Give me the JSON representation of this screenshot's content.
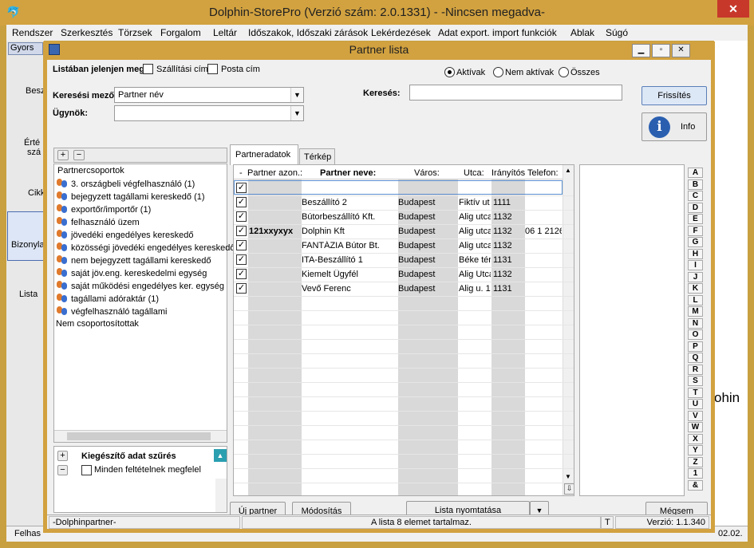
{
  "main_window": {
    "title": "Dolphin-StorePro  (Verzió szám: 2.0.1331) - -Nincsen megadva-",
    "close": "✕"
  },
  "menu": [
    "Rendszer",
    "Szerkesztés",
    "Törzsek",
    "Forgalom",
    "Leltár",
    "Időszakok, Időszaki zárások",
    "Lekérdezések",
    "Adat export. import funkciók",
    "Ablak",
    "Súgó"
  ],
  "background": {
    "fragments": [
      "Gyors",
      "Besz",
      "Érté",
      "szá",
      "Cikk",
      "Bizonyla",
      "Lista",
      "Felhas",
      "ohin",
      "02.02."
    ]
  },
  "child_window": {
    "title": "Partner lista",
    "filter_label": "Listában jelenjen meg:",
    "cb_shipping": "Szállítási cím",
    "cb_mail": "Posta cím",
    "radio_active": "Aktívak",
    "radio_inactive": "Nem aktívak",
    "radio_all": "Összes",
    "search_field_label": "Keresési mező:",
    "search_field_value": "Partner név",
    "agent_label": "Ügynök:",
    "search_label": "Keresés:",
    "refresh": "Frissítés",
    "info": "Info",
    "plus": "+",
    "minus": "−",
    "extra_filter": "Kiegészítő adat szűrés",
    "all_conditions": "Minden feltételnek megfelel",
    "tab_partner": "Partneradatok",
    "tab_map": "Térkép",
    "new_partner": "Új partner",
    "modify": "Módosítás",
    "print_list": "Lista nyomtatása",
    "cancel": "Mégsem",
    "status_left": "-Dolphinpartner-",
    "status_mid": "A lista 8 elemet tartalmaz.",
    "status_t": "T",
    "status_version": "Verzió: 1.1.340"
  },
  "tree": {
    "root": "Partnercsoportok",
    "items": [
      "3. országbeli végfelhasználó (1)",
      "bejegyzett tagállami kereskedő (1)",
      "exportőr/importőr (1)",
      "felhasználó üzem",
      "jövedéki engedélyes kereskedő",
      "közösségi jövedéki engedélyes kereskedő",
      "nem bejegyzett tagállami kereskedő",
      "saját jöv.eng. kereskedelmi egység",
      "saját működési engedélyes ker. egység",
      "tagállami adóraktár (1)",
      "végfelhasználó tagállami"
    ],
    "ungrouped": "Nem csoportosítottak"
  },
  "grid": {
    "headers": [
      "-",
      "Partner azon.:",
      "Partner neve:",
      "Város:",
      "Utca:",
      "Irányítós",
      "Telefon:"
    ],
    "rows": [
      {
        "id": "",
        "name": "",
        "city": "",
        "street": "",
        "zip": "",
        "phone": ""
      },
      {
        "id": "",
        "name": "Beszállító 2",
        "city": "Budapest",
        "street": "Fiktív ut",
        "zip": "1111",
        "phone": ""
      },
      {
        "id": "",
        "name": "Bútorbeszállító Kft.",
        "city": "Budapest",
        "street": "Alig utca",
        "zip": "1132",
        "phone": ""
      },
      {
        "id": "121xxyxyx",
        "name": "Dolphin Kft",
        "city": "Budapest",
        "street": "Alig utca",
        "zip": "1132",
        "phone": "06 1 2126"
      },
      {
        "id": "",
        "name": "FANTÁZIA Bútor Bt.",
        "city": "Budapest",
        "street": "Alig utca",
        "zip": "1132",
        "phone": ""
      },
      {
        "id": "",
        "name": "ITA-Beszállító 1",
        "city": "Budapest",
        "street": "Béke tér",
        "zip": "1131",
        "phone": ""
      },
      {
        "id": "",
        "name": "Kiemelt Ügyfél",
        "city": "Budapest",
        "street": "Alig Utca",
        "zip": "1132",
        "phone": ""
      },
      {
        "id": "",
        "name": "Vevő Ferenc",
        "city": "Budapest",
        "street": "Alig u. 1",
        "zip": "1131",
        "phone": ""
      }
    ]
  },
  "alphabet": [
    "A",
    "B",
    "C",
    "D",
    "E",
    "F",
    "G",
    "H",
    "I",
    "J",
    "K",
    "L",
    "M",
    "N",
    "O",
    "P",
    "Q",
    "R",
    "S",
    "T",
    "U",
    "V",
    "W",
    "X",
    "Y",
    "Z",
    "1",
    "&"
  ]
}
